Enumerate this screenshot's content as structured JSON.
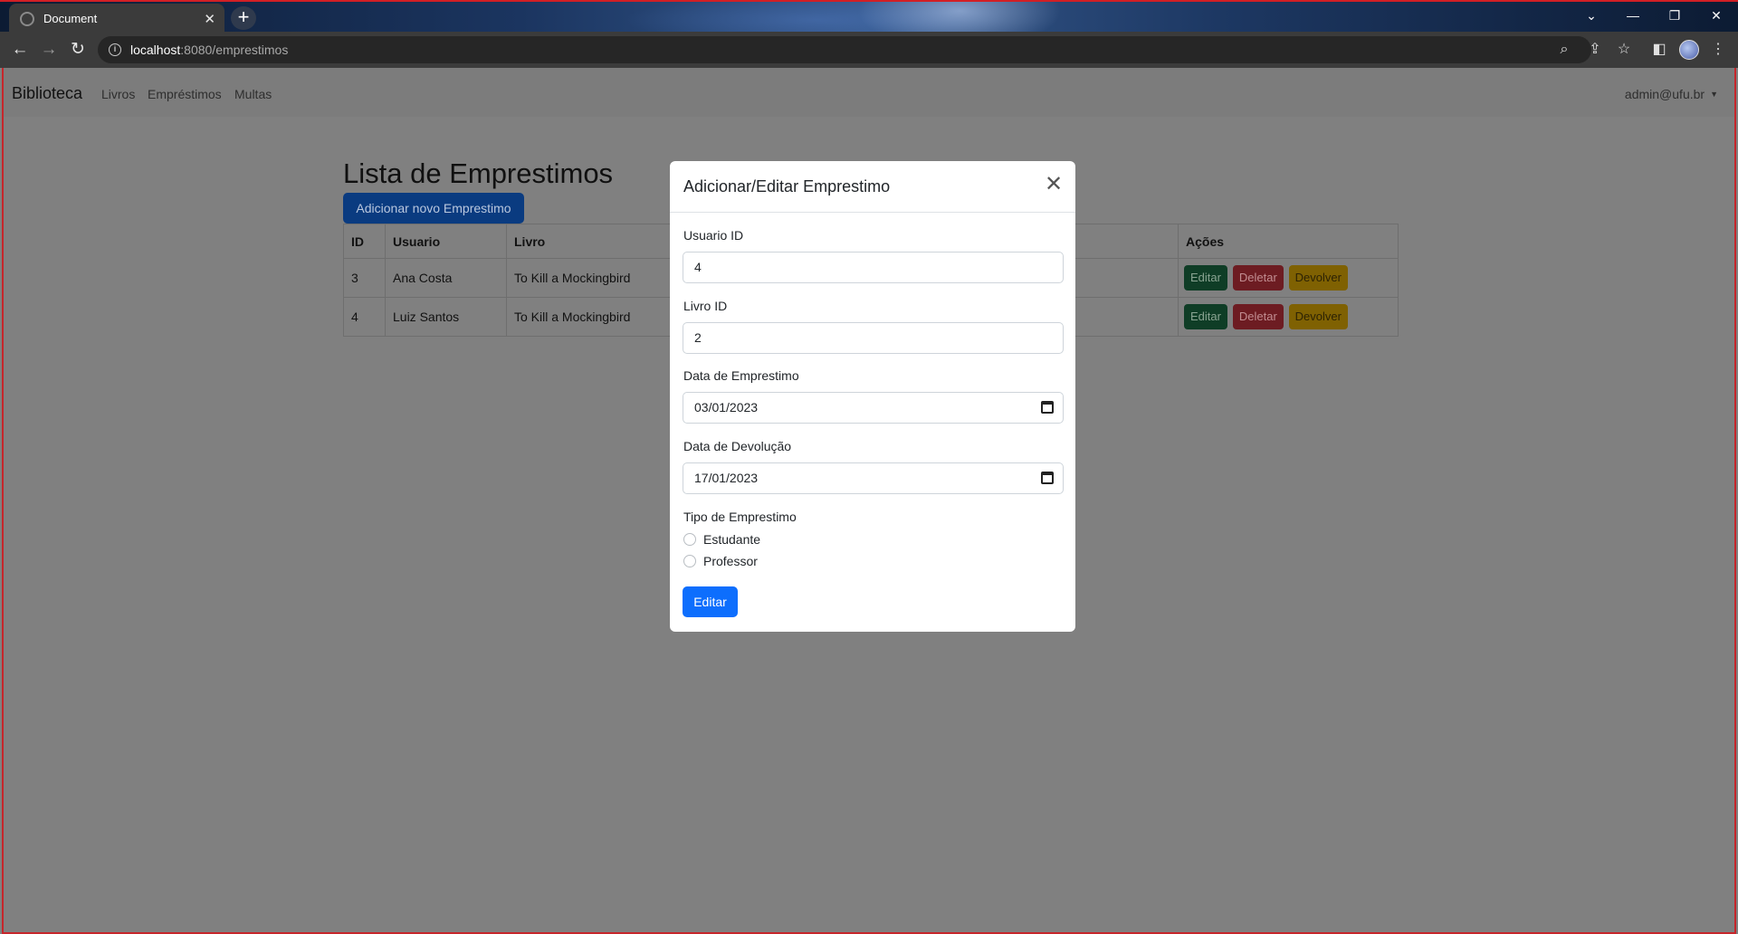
{
  "browser": {
    "tab_title": "Document",
    "tab_close": "✕",
    "new_tab": "+",
    "url_host": "localhost",
    "url_path": ":8080/emprestimos",
    "window_controls": [
      "⌄",
      "—",
      "❐",
      "✕"
    ]
  },
  "navbar": {
    "brand": "Biblioteca",
    "links": [
      "Livros",
      "Empréstimos",
      "Multas"
    ],
    "user": "admin@ufu.br"
  },
  "main": {
    "title": "Lista de Emprestimos",
    "add_button": "Adicionar novo Emprestimo",
    "table": {
      "headers": [
        "ID",
        "Usuario",
        "Livro",
        "",
        "Ações"
      ],
      "rows": [
        {
          "id": "3",
          "usuario": "Ana Costa",
          "livro": "To Kill a Mockingbird"
        },
        {
          "id": "4",
          "usuario": "Luiz Santos",
          "livro": "To Kill a Mockingbird"
        }
      ],
      "actions": {
        "edit": "Editar",
        "delete": "Deletar",
        "return": "Devolver"
      }
    }
  },
  "modal": {
    "title": "Adicionar/Editar Emprestimo",
    "close": "✕",
    "fields": {
      "usuario_label": "Usuario ID",
      "usuario_value": "4",
      "livro_label": "Livro ID",
      "livro_value": "2",
      "data_emprestimo_label": "Data de Emprestimo",
      "data_emprestimo_value": "03/01/2023",
      "data_devolucao_label": "Data de Devolução",
      "data_devolucao_value": "17/01/2023"
    },
    "tipo_label": "Tipo de Emprestimo",
    "tipo_options": [
      "Estudante",
      "Professor"
    ],
    "submit": "Editar"
  }
}
